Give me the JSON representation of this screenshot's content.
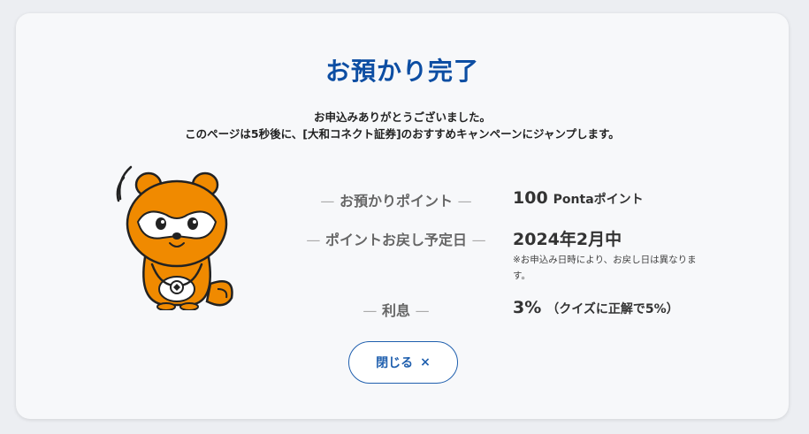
{
  "dialog": {
    "title": "お預かり完了",
    "message_line1": "お申込みありがとうございました。",
    "message_line2": "このページは5秒後に、[大和コネクト証券]のおすすめキャンペーンにジャンプします。"
  },
  "rows": {
    "points": {
      "label": "お預かりポイント",
      "value": "100",
      "unit": "Pontaポイント"
    },
    "return_date": {
      "label": "ポイントお戻し予定日",
      "value": "2024年2月中",
      "note": "※お申込み日時により、お戻し日は異なります。"
    },
    "interest": {
      "label": "利息",
      "value": "3%",
      "unit": "（クイズに正解で5%）"
    }
  },
  "close_button": {
    "label": "閉じる",
    "icon": "×"
  },
  "colors": {
    "accent": "#0d4ea3",
    "mascot": "#f08a00"
  }
}
